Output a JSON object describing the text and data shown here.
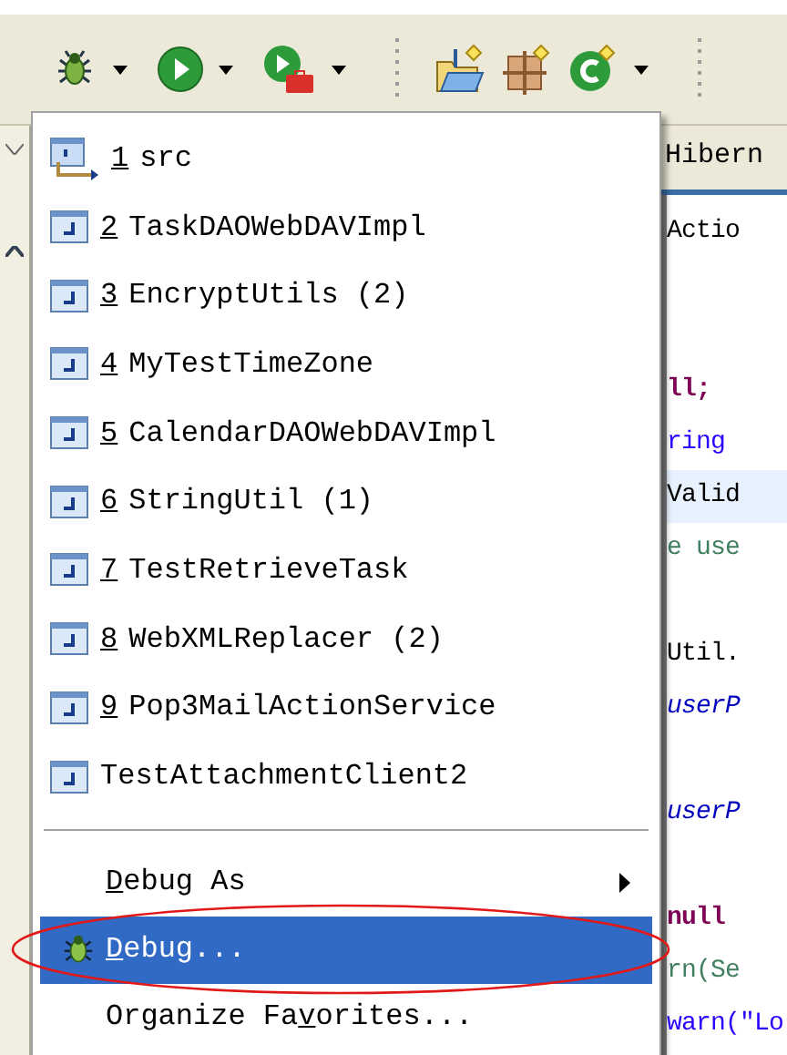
{
  "toolbar": {
    "buttons": [
      {
        "kind": "bug",
        "dropdown": true
      },
      {
        "kind": "run",
        "dropdown": true
      },
      {
        "kind": "external-tools",
        "dropdown": true
      },
      {
        "kind": "separator"
      },
      {
        "kind": "new-project",
        "dropdown": false
      },
      {
        "kind": "new-package",
        "dropdown": false
      },
      {
        "kind": "new-class",
        "dropdown": true
      },
      {
        "kind": "separator"
      }
    ]
  },
  "menu": {
    "items": [
      {
        "kind": "folder",
        "mnemonic": "1",
        "label": "src"
      },
      {
        "kind": "class",
        "mnemonic": "2",
        "label": "TaskDAOWebDAVImpl"
      },
      {
        "kind": "class",
        "mnemonic": "3",
        "label": "EncryptUtils (2)"
      },
      {
        "kind": "class",
        "mnemonic": "4",
        "label": "MyTestTimeZone"
      },
      {
        "kind": "class",
        "mnemonic": "5",
        "label": "CalendarDAOWebDAVImpl"
      },
      {
        "kind": "class",
        "mnemonic": "6",
        "label": "StringUtil (1)"
      },
      {
        "kind": "class",
        "mnemonic": "7",
        "label": "TestRetrieveTask"
      },
      {
        "kind": "class",
        "mnemonic": "8",
        "label": "WebXMLReplacer (2)"
      },
      {
        "kind": "class",
        "mnemonic": "9",
        "label": "Pop3MailActionService"
      },
      {
        "kind": "class",
        "label": "TestAttachmentClient2"
      },
      {
        "kind": "separator"
      },
      {
        "kind": "command",
        "key": "D",
        "post": "ebug As",
        "submenu": true,
        "selected": false,
        "circled": false
      },
      {
        "kind": "debug",
        "key": "D",
        "post": "ebug...",
        "submenu": false,
        "selected": true,
        "circled": true
      },
      {
        "kind": "command",
        "pre": "Organize Fa",
        "key": "v",
        "post": "orites...",
        "submenu": false,
        "selected": false,
        "circled": false
      }
    ]
  },
  "editor": {
    "tab": "Hibern",
    "lines": [
      {
        "kind": "plain",
        "text": "Actio"
      },
      {
        "kind": "blank"
      },
      {
        "kind": "blank"
      },
      {
        "kind": "keyword",
        "text": "ll;"
      },
      {
        "kind": "string",
        "text": "ring"
      },
      {
        "kind": "current",
        "text": "Valid"
      },
      {
        "kind": "comment",
        "text": "e use"
      },
      {
        "kind": "blank"
      },
      {
        "kind": "plain",
        "text": "Util."
      },
      {
        "kind": "field",
        "text": "userP"
      },
      {
        "kind": "blank"
      },
      {
        "kind": "field",
        "text": "userP"
      },
      {
        "kind": "blank"
      },
      {
        "kind": "keyword",
        "text": "null"
      },
      {
        "kind": "comment",
        "text": "rn(Se"
      },
      {
        "kind": "string",
        "text": "warn(\"Lo"
      }
    ]
  }
}
